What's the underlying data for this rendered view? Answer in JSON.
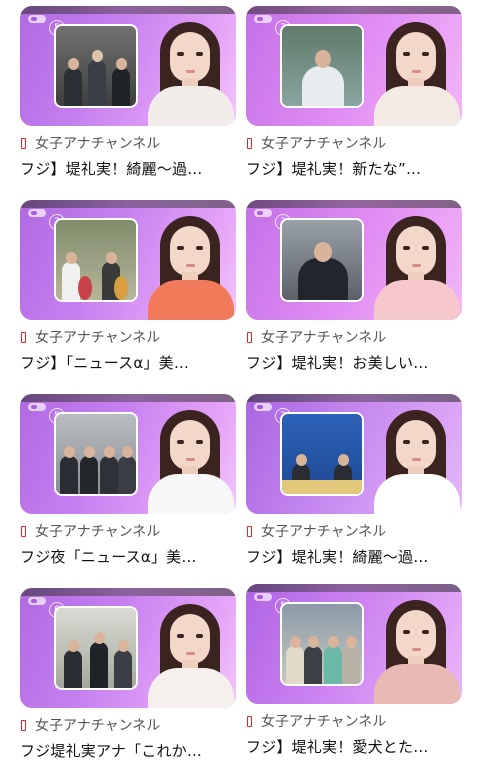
{
  "feed": {
    "cards": [
      {
        "channel": "女子アナチャンネル",
        "title": "フジ】堤礼実！綺麗〜過…",
        "index": "5"
      },
      {
        "channel": "女子アナチャンネル",
        "title": "フジ】堤礼実！新たな”…",
        "index": "7"
      },
      {
        "channel": "女子アナチャンネル",
        "title": "フジ】「ニュースα」美…",
        "index": "2"
      },
      {
        "channel": "女子アナチャンネル",
        "title": "フジ】堤礼実！お美しい…",
        "index": "3"
      },
      {
        "channel": "女子アナチャンネル",
        "title": "フジ夜「ニュースα」美…",
        "index": "5"
      },
      {
        "channel": "女子アナチャンネル",
        "title": "フジ】堤礼実！綺麗〜過…",
        "index": "2"
      },
      {
        "channel": "女子アナチャンネル",
        "title": "フジ堤礼実アナ「これか…",
        "index": "6"
      },
      {
        "channel": "女子アナチャンネル",
        "title": "フジ】堤礼実！愛犬とた…",
        "index": "5"
      }
    ]
  },
  "colors": {
    "thumb_purple": "#c77ff0",
    "channel_icon_red": "#e0262b",
    "title_text": "#111111",
    "channel_text": "#555555"
  },
  "icons": {
    "channel": "channel-bookmark-icon"
  }
}
